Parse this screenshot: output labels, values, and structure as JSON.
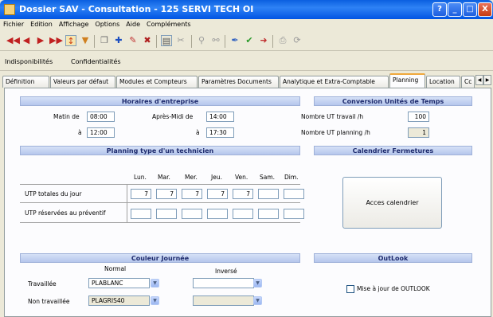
{
  "window": {
    "title": "Dossier SAV - Consultation - 125 SERVI TECH OI",
    "help_label": "?",
    "min_label": "_",
    "max_label": "□",
    "close_label": "X"
  },
  "menu": [
    "Fichier",
    "Edition",
    "Affichage",
    "Options",
    "Aide",
    "Compléments"
  ],
  "toolbar": {
    "icons": [
      "first-record-icon",
      "previous-record-icon",
      "next-record-icon",
      "last-record-icon",
      "sort-icon",
      "filter-icon",
      "copy-icon",
      "add-icon",
      "edit-icon",
      "delete-icon",
      "document-icon",
      "attach-icon",
      "search-icon",
      "binoculars-icon",
      "tool-icon",
      "validate-icon",
      "pointer-icon",
      "print-icon",
      "history-icon"
    ],
    "glyphs": [
      "◀◀",
      "◀",
      "▶",
      "▶▶",
      "↕",
      "▼",
      "❐",
      "✚",
      "✎",
      "✖",
      "▤",
      "✂",
      "⚲",
      "⚯",
      "✒",
      "✔",
      "➜",
      "⎙",
      "⟳"
    ]
  },
  "subtoolbar": [
    "Indisponibilités",
    "Confidentialités"
  ],
  "tabs": [
    "Définition",
    "Valeurs par défaut",
    "Modules et Compteurs",
    "Paramètres Documents",
    "Analytique et Extra-Comptable",
    "Planning",
    "Location",
    "Cc"
  ],
  "active_tab": "Planning",
  "horaires": {
    "title": "Horaires d'entreprise",
    "matin_label": "Matin de",
    "matin_de": "08:00",
    "matin_a_label": "à",
    "matin_a": "12:00",
    "apres_label": "Après-Midi de",
    "apres_de": "14:00",
    "apres_a_label": "à",
    "apres_a": "17:30"
  },
  "conversion": {
    "title": "Conversion Unités de Temps",
    "travail_label": "Nombre UT travail /h",
    "travail_value": "100",
    "planning_label": "Nombre UT planning /h",
    "planning_value": "1"
  },
  "planning": {
    "title": "Planning type d'un technicien",
    "days": [
      "Lun.",
      "Mar.",
      "Mer.",
      "Jeu.",
      "Ven.",
      "Sam.",
      "Dim."
    ],
    "row1_label": "UTP totales du jour",
    "row1_values": [
      "7",
      "7",
      "7",
      "7",
      "7",
      "",
      ""
    ],
    "row2_label": "UTP réservées au préventif",
    "row2_values": [
      "",
      "",
      "",
      "",
      "",
      "",
      ""
    ]
  },
  "calendrier": {
    "title": "Calendrier Fermetures",
    "button_label": "Acces calendrier"
  },
  "couleur": {
    "title": "Couleur Journée",
    "normal_header": "Normal",
    "inverse_header": "Inversé",
    "travaillee_label": "Travaillée",
    "travaillee_normal": "PLABLANC",
    "travaillee_inverse": "",
    "non_travaillee_label": "Non travaillée",
    "non_travaillee_normal": "PLAGRIS40",
    "non_travaillee_inverse": ""
  },
  "outlook": {
    "title": "OutLook",
    "checkbox_label": "Mise à jour de OUTLOOK",
    "checked": false
  }
}
